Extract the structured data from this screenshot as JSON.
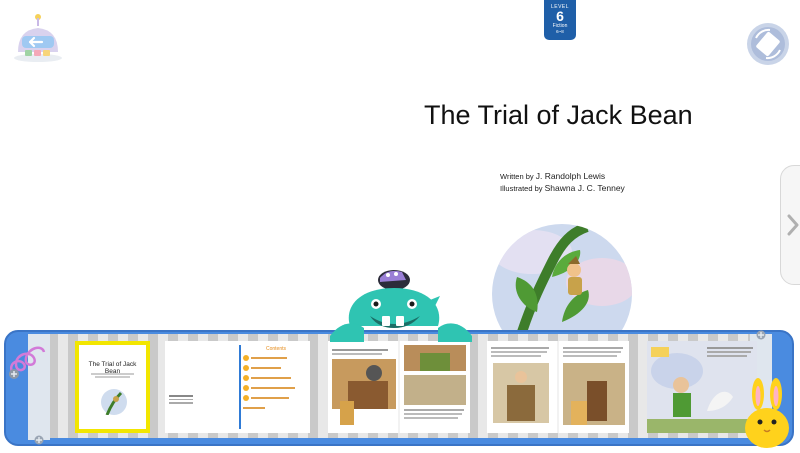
{
  "header": {
    "level_badge": {
      "level_word": "LEVEL",
      "level_number": "6",
      "genre": "Fiction",
      "age": "6~8"
    }
  },
  "book": {
    "title": "The Trial of Jack Bean",
    "writer_label": "Written by",
    "writer": "J. Randolph Lewis",
    "illustrator_label": "Illustrated by",
    "illustrator": "Shawna J. C. Tenney"
  },
  "thumbnails": {
    "cover": {
      "title": "The Trial of Jack Bean"
    },
    "contents": {
      "heading": "Contents"
    }
  },
  "colors": {
    "tray": "#4a8be0",
    "level_badge": "#1f5fa8",
    "selected_thumb": "#f2e600",
    "monster": "#2fc4b2",
    "bunny": "#ffd21c"
  },
  "icons": {
    "back": "robot-back-arrow-icon",
    "rotate": "rotate-icon",
    "next_page": "chevron-right-icon"
  }
}
